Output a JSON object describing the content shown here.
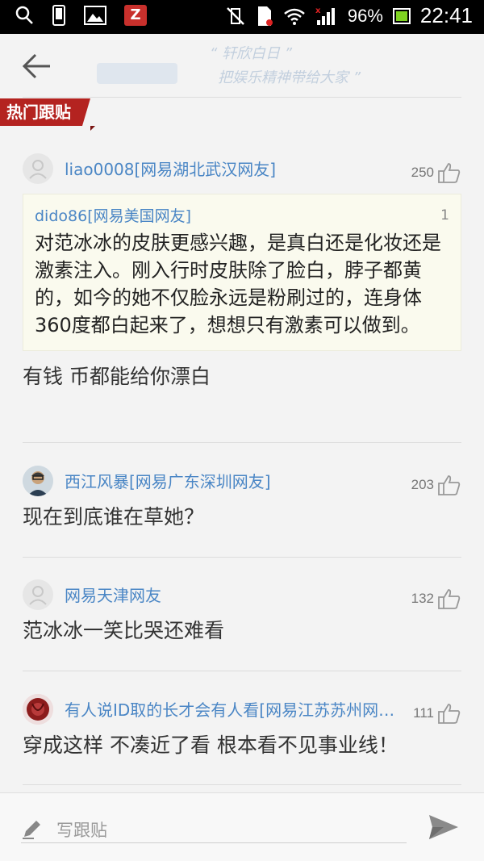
{
  "status_bar": {
    "battery": "96%",
    "time": "22:41",
    "app_badge": "Z"
  },
  "header": {
    "banner_line1": "“ 轩欣白日 ”",
    "banner_line2": "把娱乐精神带给大家 ”"
  },
  "section_tag": "热门跟贴",
  "comments": [
    {
      "user": "liao0008[网易湖北武汉网友]",
      "likes": "250",
      "quote": {
        "user": "dido86[网易美国网友]",
        "floor": "1",
        "text": "对范冰冰的皮肤更感兴趣，是真白还是化妆还是激素注入。刚入行时皮肤除了脸白，脖子都黄的，如今的她不仅脸永远是粉刷过的，连身体360度都白起来了，想想只有激素可以做到。"
      },
      "text": "有钱 币都能给你漂白"
    },
    {
      "user": "西江风暴[网易广东深圳网友]",
      "likes": "203",
      "text": "现在到底谁在草她？"
    },
    {
      "user": "网易天津网友",
      "likes": "132",
      "text": "范冰冰一笑比哭还难看"
    },
    {
      "user": "有人说ID取的长才会有人看[网易江苏苏州网友]",
      "likes": "111",
      "text": "穿成这样 不凑近了看 根本看不见事业线！"
    }
  ],
  "reply": {
    "placeholder": "写跟贴"
  },
  "colors": {
    "accent_red": "#b42320",
    "link_blue": "#4a86c5"
  }
}
